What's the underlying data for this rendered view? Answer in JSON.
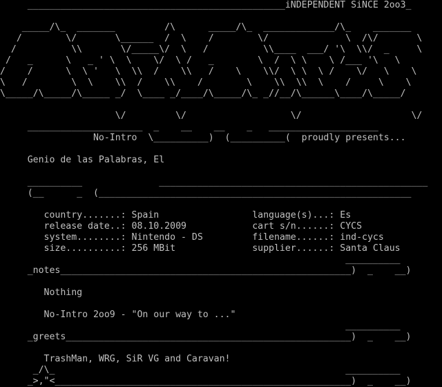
{
  "nfo": {
    "lines": [
      "     _______________________________________________iNDEPENDENT SiNCE 2oo3_",
      "",
      "    _____/\\_  _______         /\\      _____/\\_  _____________/\\_    _______",
      "   /        \\/       \\______  /  \\    /        \\/              \\  /\\/       \\",
      "  /          \\\\       \\/_____\\/  \\   /          \\\\____  ___/ '\\  \\\\/  _     \\",
      " /   _      \\   _ ' \\  \\    \\/  \\ /   _        \\  /  \\ \\    \\ /___ '\\   \\",
      "/    /      \\  \\ '   \\  \\\\  /    \\\\   /    \\    \\\\/  \\ \\  \\ /    \\/   \\    \\",
      "\\   /        \\  \\    \\\\  /    \\\\    /        \\    \\\\  \\\\  \\    /     \\    \\",
      "\\_____/\\_____/\\_____ _/  \\____ _/____/\\_____/\\_ _//__/\\______\\____/\\_____/",
      "",
      "                     \\/         \\/                   \\/                    \\/",
      "     _____________________  _    __    __    _   ____________________",
      "                 No-Intro  \\__________)  (__________(  proudly presents...",
      "",
      "     Genio de las Palabras, El",
      "",
      "     __________              _________________________________________________",
      "     (__      _  (_________________________________________________________",
      "",
      "        country.......: Spain                 language(s)...: Es",
      "        release date..: 08.10.2009            cart s/n......: CYCS",
      "        system........: Nintendo - DS         filename......: ind-cycs",
      "        size..........: 256 MBit              supplier......: Santa Claus",
      "                                                               __________",
      "     _notes_____________________________________________________)  _    __)",
      "",
      "        Nothing",
      "",
      "        No-Intro 2oo9 - \"On our way to ...\"",
      "                                                               __________",
      "     _greets____________________________________________________)  _    __)",
      "",
      "        TrashMan, WRG, SiR VG and Caravan!",
      "      _/\\_                                                     __________",
      "     _>,\"<______________________________________________________)  _    __)"
    ]
  }
}
